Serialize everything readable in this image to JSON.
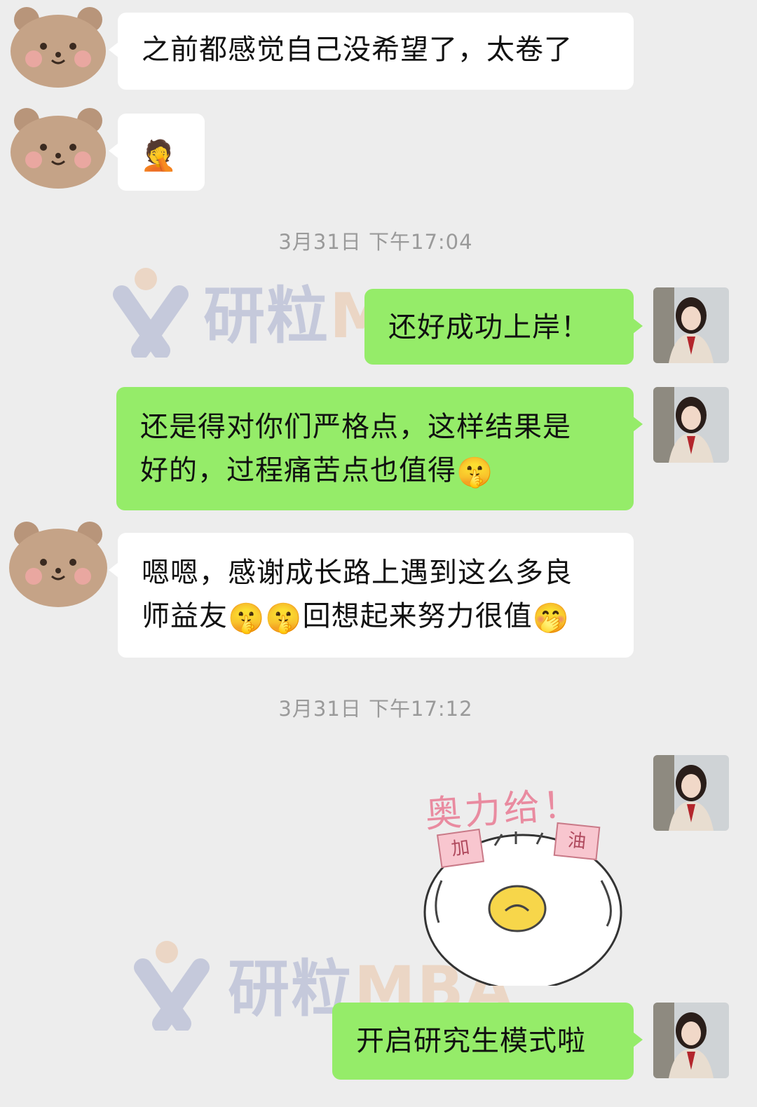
{
  "messages": [
    {
      "text": "之前都感觉自己没希望了，太卷了"
    },
    {
      "emoji": "🤦"
    },
    {
      "text": "还好成功上岸！"
    },
    {
      "line1": "还是得对你们严格点，这样结果是",
      "line2": "好的，过程痛苦点也值得",
      "emoji": "🤫"
    },
    {
      "line1": "嗯嗯，感谢成长路上遇到这么多良",
      "line2": "师益友",
      "emoji_a": "🤫",
      "emoji_b": "🤫",
      "line2b": "回想起来努力很值",
      "emoji_c": "🤭"
    },
    {
      "sticker_title": "奥力给！",
      "tag_left": "加",
      "tag_right": "油"
    },
    {
      "text": "开启研究生模式啦"
    }
  ],
  "timestamps": [
    "3月31日 下午17:04",
    "3月31日 下午17:12"
  ],
  "watermark": {
    "brand": "研粒",
    "suffix": "MBA"
  },
  "colors": {
    "outgoing_bubble": "#95ec69",
    "incoming_bubble": "#ffffff",
    "background": "#ededed"
  }
}
